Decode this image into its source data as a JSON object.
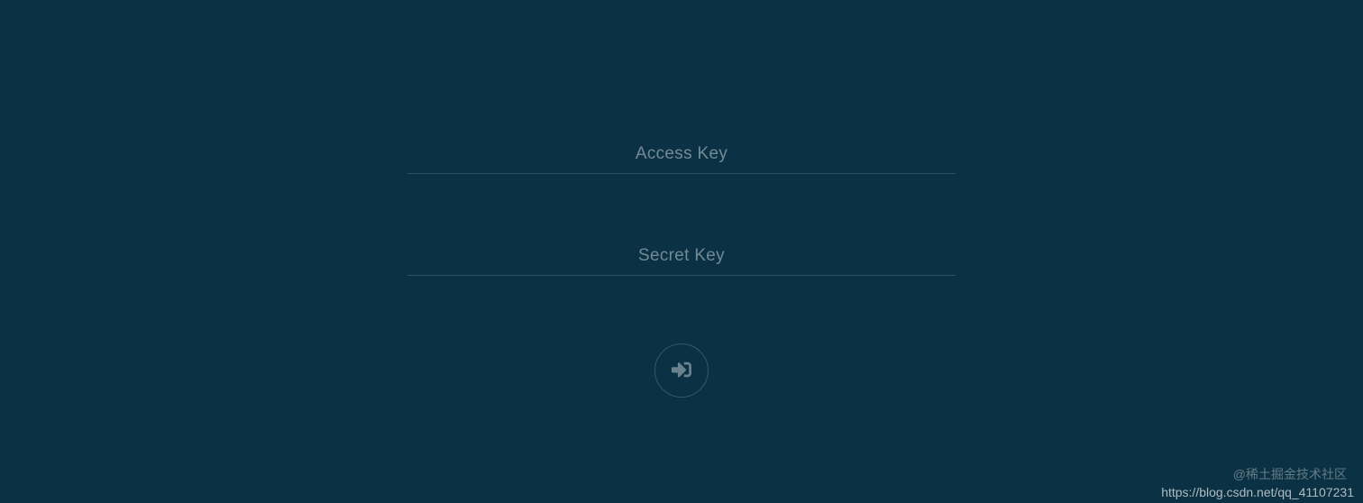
{
  "form": {
    "access_key_placeholder": "Access Key",
    "access_key_value": "",
    "secret_key_placeholder": "Secret Key",
    "secret_key_value": ""
  },
  "watermarks": {
    "community": "@稀土掘金技术社区",
    "source_url": "https://blog.csdn.net/qq_41107231"
  }
}
